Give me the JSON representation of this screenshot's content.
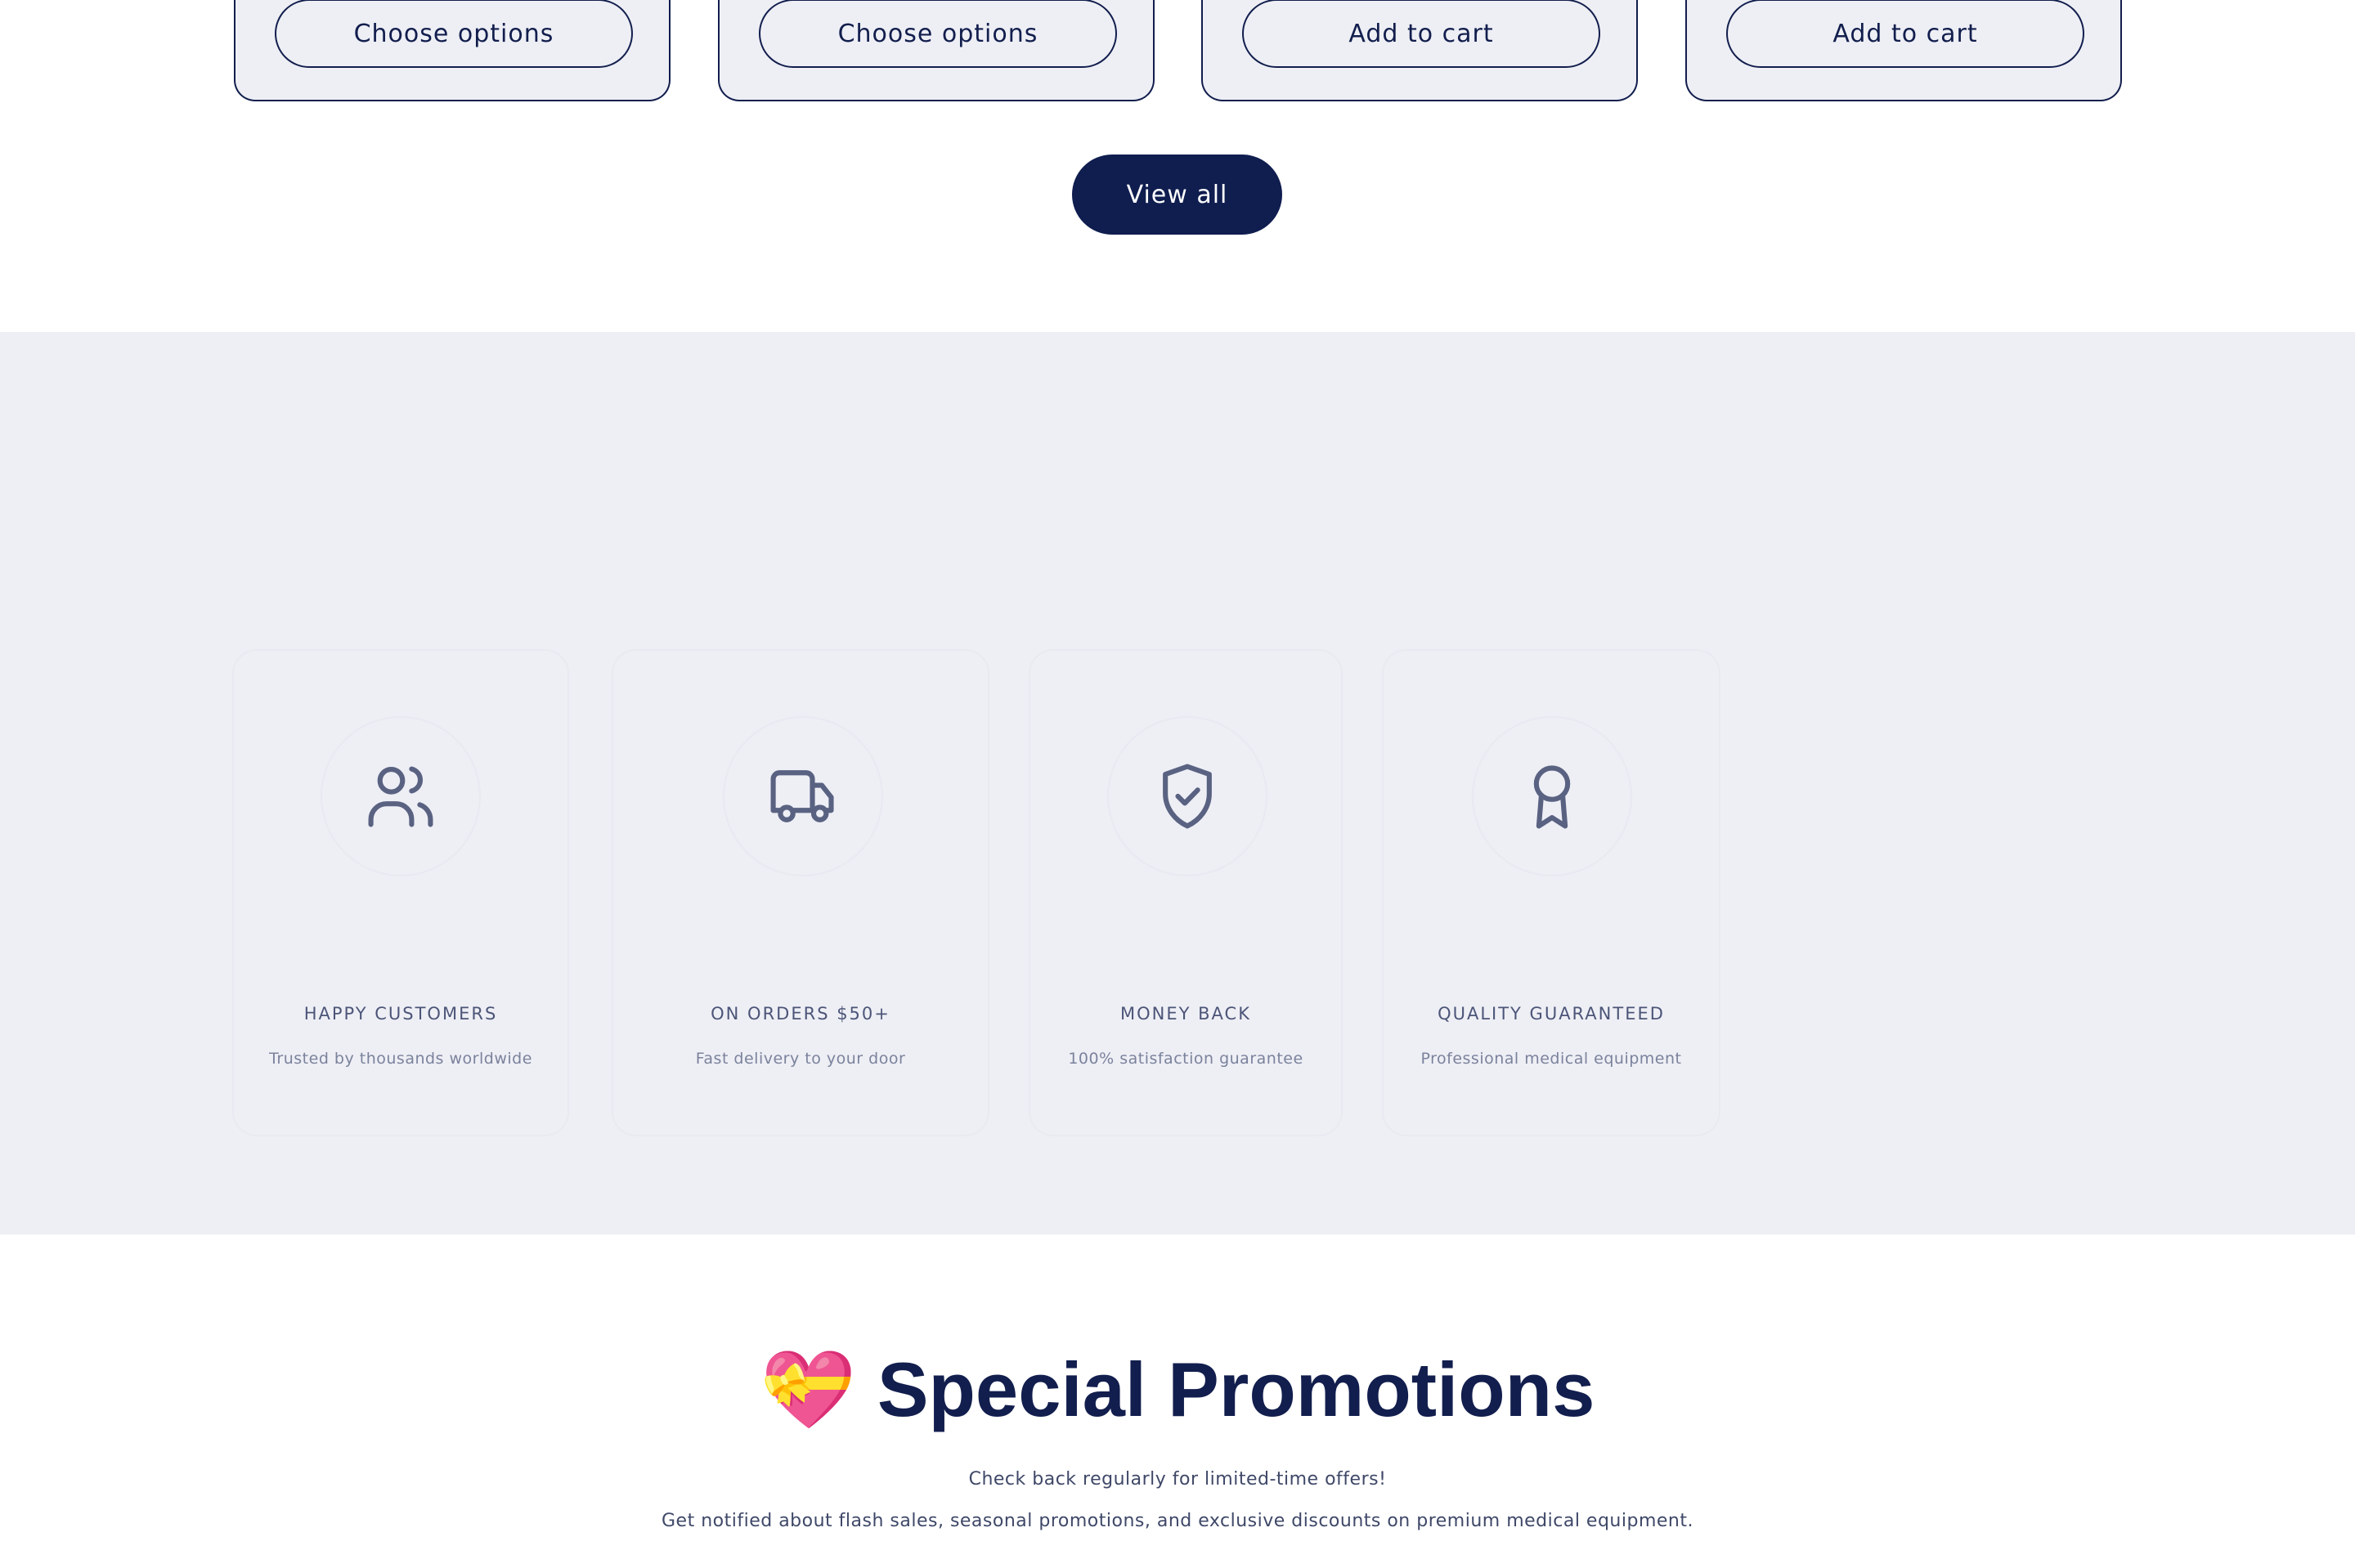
{
  "products": {
    "buttons": [
      {
        "label": "Choose options"
      },
      {
        "label": "Choose options"
      },
      {
        "label": "Add to cart"
      },
      {
        "label": "Add to cart"
      }
    ],
    "view_all_label": "View all"
  },
  "features": {
    "items": [
      {
        "icon": "users-icon",
        "title": "HAPPY CUSTOMERS",
        "desc": "Trusted by thousands worldwide"
      },
      {
        "icon": "truck-icon",
        "title": "ON ORDERS $50+",
        "desc": "Fast delivery to your door"
      },
      {
        "icon": "shield-check-icon",
        "title": "MONEY BACK",
        "desc": "100% satisfaction guarantee"
      },
      {
        "icon": "award-icon",
        "title": "QUALITY GUARANTEED",
        "desc": "Professional medical equipment"
      }
    ]
  },
  "promotions": {
    "emoji": "💝",
    "title": "Special Promotions",
    "line1": "Check back regularly for limited-time offers!",
    "line2": "Get notified about flash sales, seasonal promotions, and exclusive discounts on premium medical equipment."
  },
  "colors": {
    "primary": "#0f1d4f",
    "band_bg": "#eeeff5",
    "icon": "#5a6282"
  }
}
